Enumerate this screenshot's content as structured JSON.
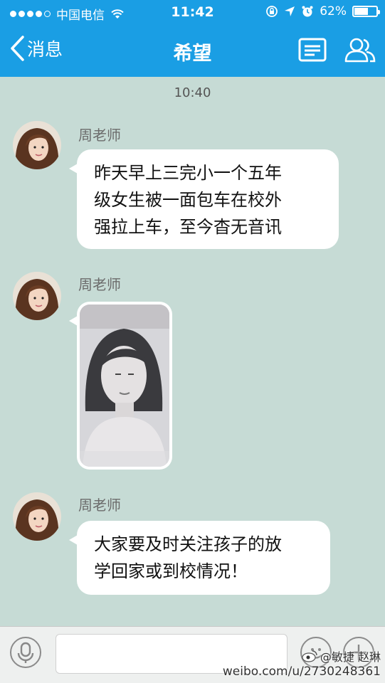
{
  "status_bar": {
    "carrier": "中国电信",
    "time": "11:42",
    "battery": "62%",
    "battery_level": 0.62
  },
  "nav": {
    "back_label": "消息",
    "title": "希望",
    "icons": [
      "profile-card-icon",
      "group-members-icon"
    ]
  },
  "chat": {
    "timestamp": "10:40",
    "messages": [
      {
        "sender": "周老师",
        "type": "text",
        "lines": [
          "昨天早上三完小一个五年",
          "级女生被一面包车在校外",
          "强拉上车，至今杳无音讯"
        ]
      },
      {
        "sender": "周老师",
        "type": "image"
      },
      {
        "sender": "周老师",
        "type": "text",
        "lines": [
          "大家要及时关注孩子的放",
          "学回家或到校情况！"
        ]
      }
    ]
  },
  "input_bar": {
    "value": "",
    "icons": [
      "voice-icon",
      "emoji-icon",
      "plus-icon"
    ]
  },
  "watermark": {
    "top": "@敏捷 赵琳",
    "url": "weibo.com/u/2730248361"
  },
  "colors": {
    "header": "#1a9ee4",
    "chat_background": "#c6dbd5",
    "bubble": "#ffffff"
  }
}
